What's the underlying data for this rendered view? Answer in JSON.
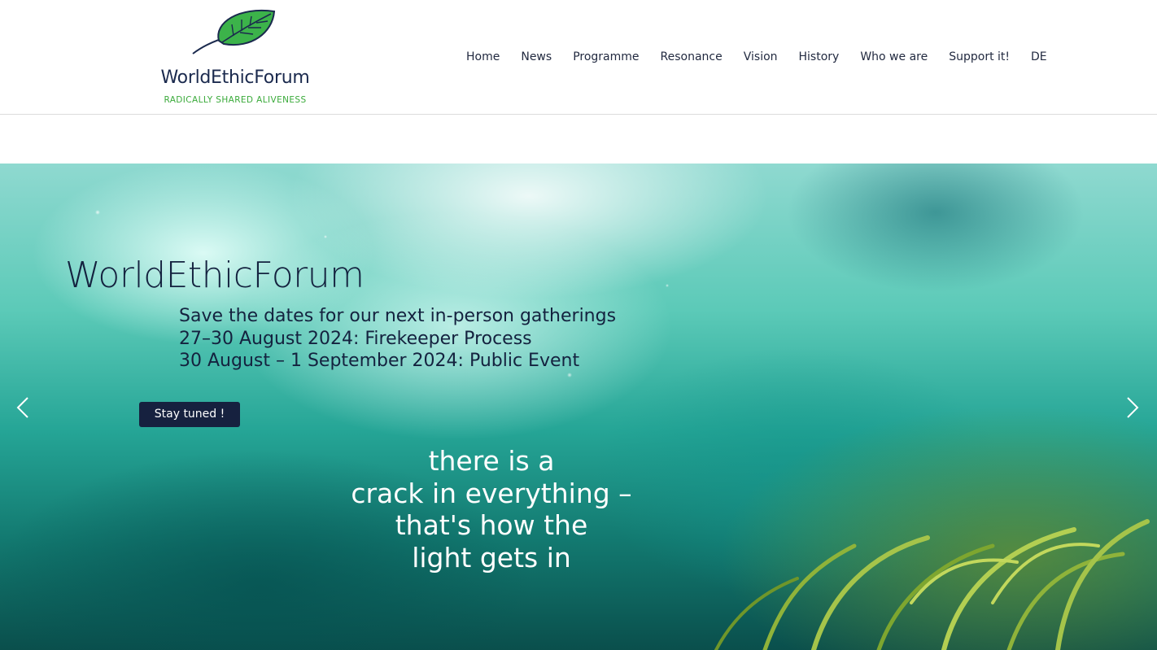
{
  "brand": {
    "name": "WorldEthicForum",
    "tagline": "RADICALLY SHARED ALIVENESS",
    "leaf_color": "#3cb34a",
    "navy": "#1b2a4e"
  },
  "nav": {
    "items": [
      {
        "label": "Home"
      },
      {
        "label": "News"
      },
      {
        "label": "Programme"
      },
      {
        "label": "Resonance"
      },
      {
        "label": "Vision"
      },
      {
        "label": "History"
      },
      {
        "label": "Who we are"
      },
      {
        "label": "Support it!"
      },
      {
        "label": "DE"
      }
    ]
  },
  "hero": {
    "title": "WorldEthicForum",
    "lines": [
      "Save the dates for our next in-person gatherings",
      "27–30 August 2024: Firekeeper Process",
      "30 August – 1 September 2024: Public Event"
    ],
    "cta_label": "Stay tuned !",
    "quote_lines": [
      "there is a",
      "crack in everything –",
      "that's how the",
      "light gets in"
    ],
    "prev_icon": "chevron-left-icon",
    "next_icon": "chevron-right-icon"
  }
}
